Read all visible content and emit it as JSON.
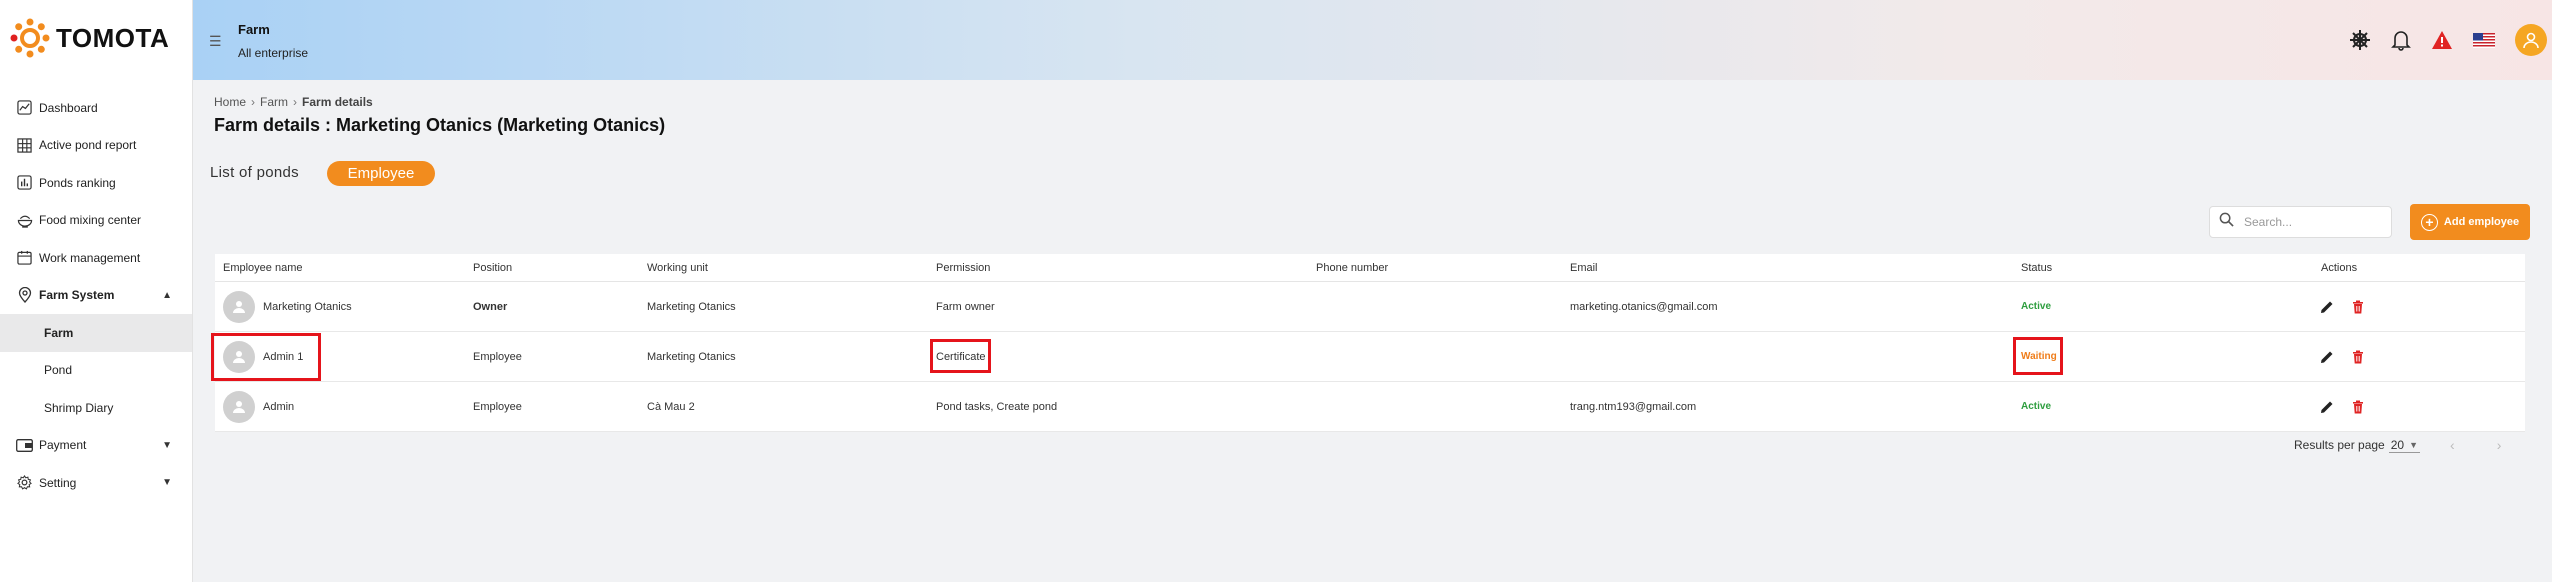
{
  "brand": {
    "name": "TOMOTA",
    "accent": "#f28c1e"
  },
  "header": {
    "title": "Farm",
    "subtitle": "All enterprise"
  },
  "sidebar": {
    "items": [
      {
        "label": "Dashboard",
        "icon": "chart-line-icon"
      },
      {
        "label": "Active pond report",
        "icon": "grid-icon"
      },
      {
        "label": "Ponds ranking",
        "icon": "bar-chart-icon"
      },
      {
        "label": "Food mixing center",
        "icon": "bowl-icon"
      },
      {
        "label": "Work management",
        "icon": "calendar-icon"
      }
    ],
    "farm_system": {
      "label": "Farm System",
      "sub": [
        "Farm",
        "Pond",
        "Shrimp Diary"
      ]
    },
    "payment": {
      "label": "Payment"
    },
    "setting": {
      "label": "Setting"
    }
  },
  "breadcrumb": {
    "home": "Home",
    "farm": "Farm",
    "current": "Farm details"
  },
  "page_title": "Farm details : Marketing Otanics (Marketing Otanics)",
  "tabs": {
    "ponds": "List of ponds",
    "employee": "Employee"
  },
  "search": {
    "placeholder": "Search..."
  },
  "add_button": "Add employee",
  "table": {
    "headers": [
      "Employee name",
      "Position",
      "Working unit",
      "Permission",
      "Phone number",
      "Email",
      "Status",
      "Actions"
    ],
    "rows": [
      {
        "name": "Marketing Otanics",
        "position": "Owner",
        "unit": "Marketing Otanics",
        "permission": "Farm owner",
        "phone": "",
        "email": "marketing.otanics@gmail.com",
        "status": "Active"
      },
      {
        "name": "Admin 1",
        "position": "Employee",
        "unit": "Marketing Otanics",
        "permission": "Certificate",
        "phone": "",
        "email": "",
        "status": "Waiting"
      },
      {
        "name": "Admin",
        "position": "Employee",
        "unit": "Cà Mau 2",
        "permission": "Pond tasks, Create pond",
        "phone": "",
        "email": "trang.ntm193@gmail.com",
        "status": "Active"
      }
    ]
  },
  "pagination": {
    "label": "Results per page",
    "value": "20"
  }
}
